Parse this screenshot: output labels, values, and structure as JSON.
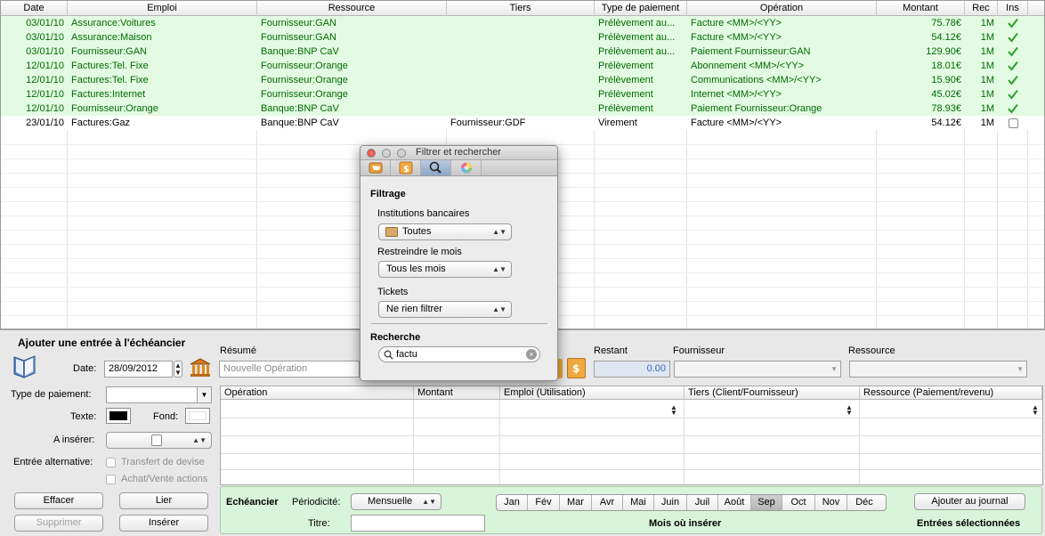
{
  "table": {
    "columns": [
      "Date",
      "Emploi",
      "Ressource",
      "Tiers",
      "Type de paiement",
      "Opération",
      "Montant",
      "Rec",
      "Ins"
    ],
    "rows": [
      {
        "date": "03/01/10",
        "emploi": "Assurance:Voitures",
        "ressource": "Fournisseur:GAN",
        "tiers": "",
        "type": "Prélèvement au...",
        "operation": "Facture <MM>/<YY>",
        "montant": "75.78€",
        "rec": "1M",
        "ins": true,
        "style": "green"
      },
      {
        "date": "03/01/10",
        "emploi": "Assurance:Maison",
        "ressource": "Fournisseur:GAN",
        "tiers": "",
        "type": "Prélèvement au...",
        "operation": "Facture <MM>/<YY>",
        "montant": "54.12€",
        "rec": "1M",
        "ins": true,
        "style": "green"
      },
      {
        "date": "03/01/10",
        "emploi": "Fournisseur:GAN",
        "ressource": "Banque:BNP CaV",
        "tiers": "",
        "type": "Prélèvement au...",
        "operation": "Paiement Fournisseur:GAN",
        "montant": "129.90€",
        "rec": "1M",
        "ins": true,
        "style": "green"
      },
      {
        "date": "12/01/10",
        "emploi": "Factures:Tel. Fixe",
        "ressource": "Fournisseur:Orange",
        "tiers": "",
        "type": "Prélèvement",
        "operation": "Abonnement <MM>/<YY>",
        "montant": "18.01€",
        "rec": "1M",
        "ins": true,
        "style": "green"
      },
      {
        "date": "12/01/10",
        "emploi": "Factures:Tel. Fixe",
        "ressource": "Fournisseur:Orange",
        "tiers": "",
        "type": "Prélèvement",
        "operation": "Communications <MM>/<YY>",
        "montant": "15.90€",
        "rec": "1M",
        "ins": true,
        "style": "green"
      },
      {
        "date": "12/01/10",
        "emploi": "Factures:Internet",
        "ressource": "Fournisseur:Orange",
        "tiers": "",
        "type": "Prélèvement",
        "operation": "Internet <MM>/<YY>",
        "montant": "45.02€",
        "rec": "1M",
        "ins": true,
        "style": "green"
      },
      {
        "date": "12/01/10",
        "emploi": "Fournisseur:Orange",
        "ressource": "Banque:BNP CaV",
        "tiers": "",
        "type": "Prélèvement",
        "operation": "Paiement Fournisseur:Orange",
        "montant": "78.93€",
        "rec": "1M",
        "ins": true,
        "style": "green"
      },
      {
        "date": "23/01/10",
        "emploi": "Factures:Gaz",
        "ressource": "Banque:BNP CaV",
        "tiers": "Fournisseur:GDF",
        "type": "Virement",
        "operation": "Facture <MM>/<YY>",
        "montant": "54.12€",
        "rec": "1M",
        "ins": false,
        "style": "white"
      }
    ]
  },
  "form": {
    "heading": "Ajouter une entrée à l'échéancier",
    "date_label": "Date:",
    "date_value": "28/09/2012",
    "resume_label": "Résumé",
    "resume_placeholder": "Nouvelle Opération",
    "restant_label": "Restant",
    "restant_value": "0.00",
    "fournisseur_label": "Fournisseur",
    "ressource_label": "Ressource",
    "type_paiement_label": "Type de paiement:",
    "texte_label": "Texte:",
    "fond_label": "Fond:",
    "a_inserer_label": "A insérer:",
    "entree_alt_label": "Entrée alternative:",
    "transfert_label": "Transfert de devise",
    "achat_label": "Achat/Vente actions",
    "grid_columns": [
      "Opération",
      "Montant",
      "Emploi (Utilisation)",
      "Tiers (Client/Fournisseur)",
      "Ressource (Paiement/revenu)"
    ],
    "buttons": {
      "effacer": "Effacer",
      "lier": "Lier",
      "supprimer": "Supprimer",
      "inserer": "Insérer"
    }
  },
  "schedule": {
    "echeancier_label": "Echéancier",
    "periodicite_label": "Périodicité:",
    "periodicite_value": "Mensuelle",
    "titre_label": "Titre:",
    "months": [
      "Jan",
      "Fév",
      "Mar",
      "Avr",
      "Mai",
      "Juin",
      "Juil",
      "Août",
      "Sep",
      "Oct",
      "Nov",
      "Déc"
    ],
    "selected_month": "Sep",
    "mois_label": "Mois où insérer",
    "ajouter_button": "Ajouter au journal",
    "entrees_label": "Entrées sélectionnées"
  },
  "panel": {
    "title": "Filtrer et rechercher",
    "filtrage_label": "Filtrage",
    "institutions_label": "Institutions bancaires",
    "institutions_value": "Toutes",
    "mois_label": "Restreindre le mois",
    "mois_value": "Tous les mois",
    "tickets_label": "Tickets",
    "tickets_value": "Ne rien filtrer",
    "recherche_label": "Recherche",
    "search_value": "factu"
  },
  "colors": {
    "green_row_bg": "#e3fae3",
    "green_text": "#006b00",
    "schedule_panel": "#d9f5d9"
  }
}
